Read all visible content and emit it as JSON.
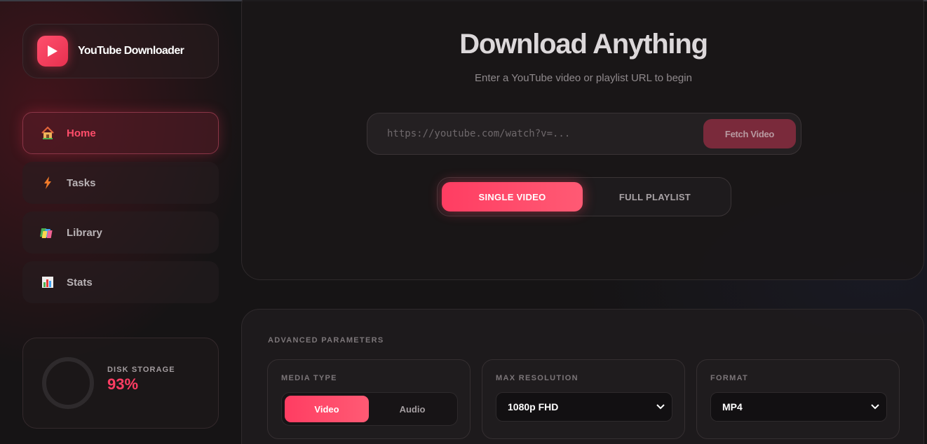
{
  "brand": {
    "name": "YouTube Downloader"
  },
  "nav": [
    {
      "label": "Home",
      "icon": "house-icon",
      "active": true
    },
    {
      "label": "Tasks",
      "icon": "lightning-icon",
      "active": false
    },
    {
      "label": "Library",
      "icon": "books-icon",
      "active": false
    },
    {
      "label": "Stats",
      "icon": "bar-chart-icon",
      "active": false
    }
  ],
  "storage": {
    "label": "DISK STORAGE",
    "value": "93%",
    "percent": 93
  },
  "hero": {
    "title": "Download Anything",
    "subtitle": "Enter a YouTube video or playlist URL to begin",
    "url_placeholder": "https://youtube.com/watch?v=...",
    "fetch_label": "Fetch Video",
    "modes": [
      "SINGLE VIDEO",
      "FULL PLAYLIST"
    ],
    "active_mode": "SINGLE VIDEO"
  },
  "advanced": {
    "title": "ADVANCED PARAMETERS",
    "media_type": {
      "label": "MEDIA TYPE",
      "options": [
        "Video",
        "Audio"
      ],
      "selected": "Video"
    },
    "max_resolution": {
      "label": "MAX RESOLUTION",
      "selected": "1080p FHD"
    },
    "format": {
      "label": "FORMAT",
      "selected": "MP4"
    }
  },
  "colors": {
    "accent": "#ff3d62",
    "background": "#161415",
    "panel": "#1a1618"
  }
}
